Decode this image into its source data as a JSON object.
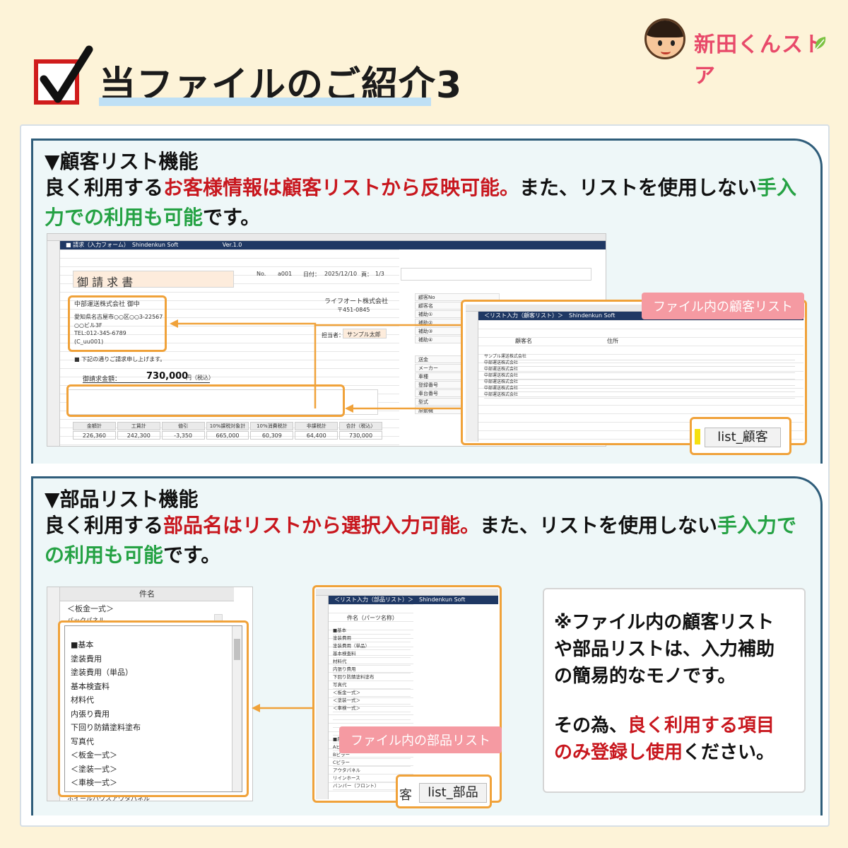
{
  "header": {
    "title": "当ファイルのご紹介3",
    "logo_text": "新田くんストア"
  },
  "section1": {
    "title": "▼顧客リスト機能",
    "text_a": "良く利用する",
    "text_b": "お客様情報は顧客リストから反映可能。",
    "text_c": "また、リストを使用しない",
    "text_d": "手入力での利用も可能",
    "text_e": "です。",
    "callout": "ファイル内の顧客リスト",
    "tab_label": "list_顧客"
  },
  "invoice": {
    "app_bar": "■ 請求（入力フォーム）　Shindenkun Soft",
    "version": "Ver.1.0",
    "title": "御 請 求 書",
    "no_label": "No.",
    "no_value": "a001",
    "date_label": "日付：",
    "date_value": "2025/12/10",
    "page_label": "頁：",
    "page_value": "1/3",
    "customer": "中部運送株式会社 御中",
    "address": "愛知県名古屋市○○区○○3-22567",
    "address2": "○○ビル3F",
    "tel": "TEL:012-345-6789",
    "code": "(C_uu001)",
    "issuer": "ライフオート株式会社",
    "zip": "〒451-0845",
    "contact_label": "担当者：",
    "contact_value": "サンプル太郎",
    "note": "■ 下記の通りご請求申し上げます。",
    "total_label": "御請求金額：",
    "total_value": "730,000",
    "total_unit": "円（税込）",
    "sum_headers": [
      "金額計",
      "工賃計",
      "値引",
      "10%課税対象計",
      "10%消費税計",
      "非課税計",
      "合計（税込）"
    ],
    "sum_values": [
      "226,360",
      "242,300",
      "-3,350",
      "665,000",
      "60,309",
      "64,400",
      "730,000"
    ],
    "customer_panel": [
      "顧客No",
      "顧客名",
      "補助①",
      "補助②",
      "補助③",
      "補助④"
    ],
    "vehicle_panel": [
      "送金",
      "メーカー",
      "車種",
      "登録番号",
      "車台番号",
      "型式",
      "原動機"
    ]
  },
  "customer_list": {
    "bar": "＜リスト入力（顧客リスト）＞　Shindenkun Soft",
    "col_name": "顧客名",
    "col_addr": "住所",
    "rows": [
      "サンプル運送株式会社",
      "中部運送株式会社",
      "中部運送株式会社",
      "中部運送株式会社",
      "中部運送株式会社",
      "中部運送株式会社",
      "中部運送株式会社"
    ]
  },
  "section2": {
    "title": "▼部品リスト機能",
    "text_a": "良く利用する",
    "text_b": "部品名はリストから選択入力可能。",
    "text_c": "また、リストを使用しない",
    "text_d": "手入力で",
    "text_e": "の利用も可能",
    "text_f": "です。",
    "callout": "ファイル内の部品リスト",
    "tab_label": "list_部品",
    "tab_partial": "客"
  },
  "dropdown": {
    "header": "件名",
    "row1": "＜板金一式＞",
    "row2": "バックパネル",
    "items": [
      "■基本",
      "塗装費用",
      "塗装費用（単品）",
      "基本検査料",
      "材料代",
      "内張り費用",
      "下回り防錆塗料塗布",
      "写真代",
      "＜板金一式＞",
      "＜塗装一式＞",
      "＜車検一式＞"
    ],
    "bottom": "ホイールハウスアウタパネル"
  },
  "parts_list": {
    "bar": "＜リスト入力（部品リスト）＞　Shindenkun Soft",
    "col_name": "件名（パーツ名称）",
    "items": [
      "■基本",
      "塗装費用",
      "塗装費用（単品）",
      "基本検査料",
      "材料代",
      "内張り費用",
      "下回り防錆塗料塗布",
      "写真代",
      "＜板金一式＞",
      "＜塗装一式＞",
      "＜車検一式＞",
      "",
      "",
      "",
      "■部品",
      "Aピラー",
      "Bピラー",
      "Cピラー",
      "アウタパネル",
      "リインホース",
      "バンパー（フロント）"
    ]
  },
  "note": {
    "line1": "※ファイル内の顧客リスト",
    "line2": "や部品リストは、入力補助",
    "line3": "の簡易的なモノです。",
    "line4a": "その為、",
    "line4b": "良く利用する項目",
    "line5a": "のみ登録し使用",
    "line5b": "ください。"
  },
  "colors": {
    "accent_red": "#c8171e",
    "accent_green": "#25a244",
    "frame_navy": "#2f5d7a",
    "highlight_orange": "#f0a23a",
    "callout_pink": "#f59aa2",
    "background": "#fdf3d8"
  },
  "icons": [
    "checkbox-icon",
    "check-mark-icon",
    "mascot-icon",
    "leaf-icon",
    "arrow-icon",
    "dropdown-arrow-icon"
  ]
}
